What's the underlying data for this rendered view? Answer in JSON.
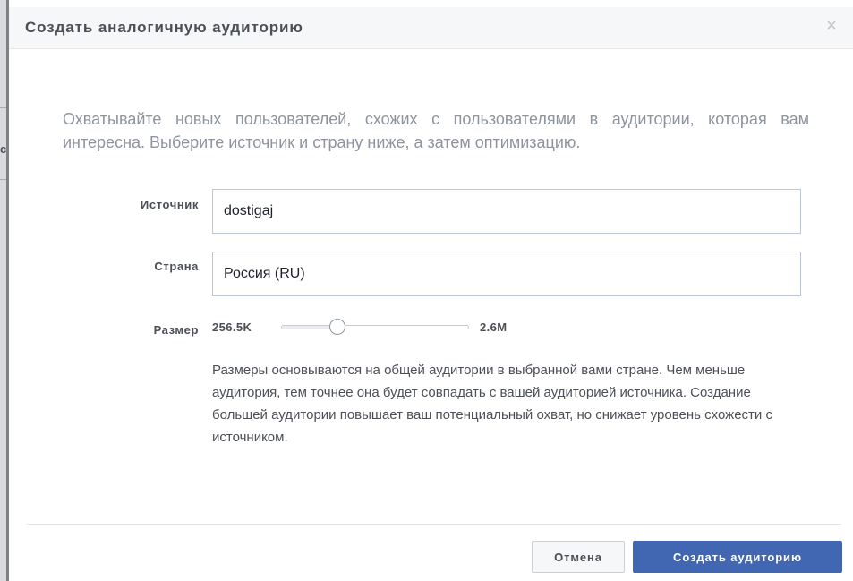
{
  "dialog": {
    "title": "Создать аналогичную аудиторию",
    "close_glyph": "×",
    "intro": "Охватывайте новых пользователей, схожих с пользователями в аудитории, которая вам интересна. Выберите источник и страну ниже, а затем оптимизацию."
  },
  "backdrop": {
    "edge_glyph": "с"
  },
  "form": {
    "source": {
      "label": "Источник",
      "value": "dostigaj"
    },
    "country": {
      "label": "Страна",
      "value": "Россия (RU)"
    },
    "size": {
      "label": "Размер",
      "min_label": "256.5K",
      "max_label": "2.6M",
      "position_fraction": 0.3
    },
    "help_text": "Размеры основываются на общей аудитории в выбранной вами стране. Чем меньше аудитория, тем точнее она будет совпадать с вашей аудиторией источника. Создание большей аудитории повышает ваш потенциальный охват, но снижает уровень схожести с источником."
  },
  "footer": {
    "cancel_label": "Отмена",
    "submit_label": "Создать аудиторию"
  },
  "colors": {
    "primary": "#4267b2",
    "header_bg": "#f6f7f9",
    "text": "#4b4f56",
    "muted_text": "#8d949e",
    "input_border": "#bdc7d8"
  },
  "icons": {
    "close": "close-icon"
  }
}
